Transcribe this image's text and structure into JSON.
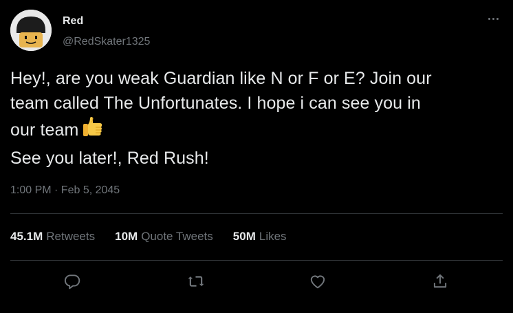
{
  "author": {
    "display_name": "Red",
    "handle": "@RedSkater1325"
  },
  "tweet": {
    "lines": [
      "Hey!, are you weak Guardian like N or F or E? Join our",
      "team called The Unfortunates. I hope i can see you in",
      "our team",
      "See you later!, Red Rush!"
    ],
    "emoji": "thumbs-up",
    "timestamp": "1:00 PM · Feb 5, 2045"
  },
  "stats": {
    "retweets_count": "45.1M",
    "retweets_label": "Retweets",
    "quotes_count": "10M",
    "quotes_label": "Quote Tweets",
    "likes_count": "50M",
    "likes_label": "Likes"
  },
  "actions": [
    "reply-icon",
    "retweet-icon",
    "like-icon",
    "share-icon"
  ],
  "colors": {
    "background": "#000000",
    "primary_text": "#e7e9ea",
    "secondary_text": "#71767b",
    "divider": "#2f3336"
  }
}
